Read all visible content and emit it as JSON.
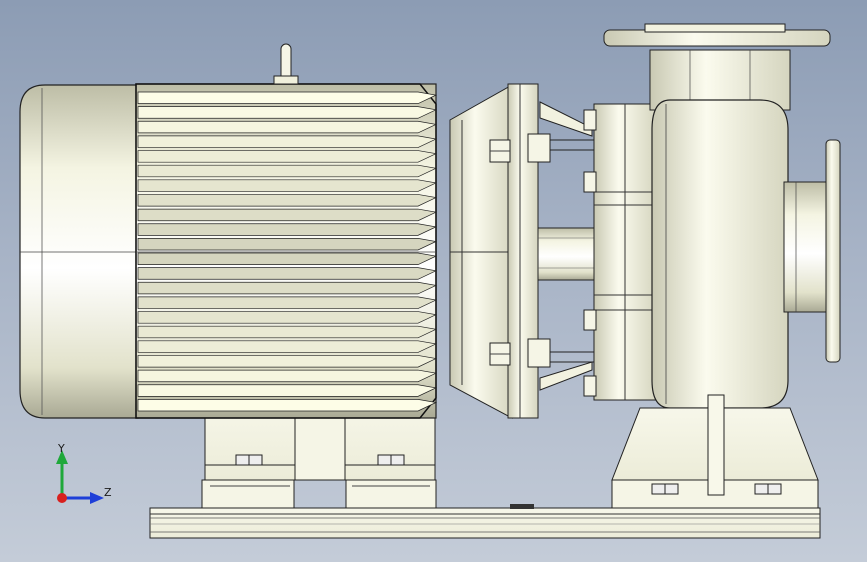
{
  "viewport": {
    "background_top": "#8c9cb4",
    "background_bottom": "#c4ccd8",
    "model_color": "#f2f2dc"
  },
  "triad": {
    "y_label": "Y",
    "z_label": "Z",
    "y_color": "#1fa83a",
    "z_color": "#1e3fd8",
    "x_color": "#d8201e"
  },
  "model": {
    "icon": "centrifugal-pump-with-motor"
  }
}
